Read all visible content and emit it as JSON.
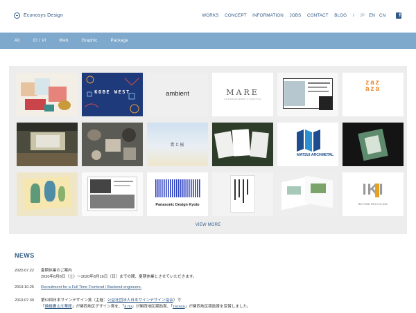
{
  "header": {
    "logo_text": "Econosys Design",
    "nav": [
      "WORKS",
      "CONCEPT",
      "INFORMATION",
      "JOBS",
      "CONTACT",
      "BLOG"
    ],
    "separator": "/",
    "languages": [
      "JP",
      "EN",
      "CN"
    ],
    "active_language": "EN",
    "facebook_icon": "facebook-icon"
  },
  "filters": [
    "All",
    "CI / VI",
    "Web",
    "Graphic",
    "Package"
  ],
  "gallery": {
    "tiles": [
      {
        "name": "tile-gift-boxes"
      },
      {
        "name": "tile-kobe-west",
        "text": "KOBE WEST"
      },
      {
        "name": "tile-ambient",
        "text": "ambient"
      },
      {
        "name": "tile-mare",
        "text": "MARE",
        "subtext": "HAIR ENHANCEMENT & HAIRSTYLE"
      },
      {
        "name": "tile-website-map"
      },
      {
        "name": "tile-zazaza",
        "text": "zazaza"
      },
      {
        "name": "tile-interior-room"
      },
      {
        "name": "tile-ceramics"
      },
      {
        "name": "tile-sky-gradient",
        "text": "青と桜"
      },
      {
        "name": "tile-brochures"
      },
      {
        "name": "tile-matsui-archmetal",
        "text": "MATSUI ARCHMETAL"
      },
      {
        "name": "tile-dark-card"
      },
      {
        "name": "tile-botanical-poster"
      },
      {
        "name": "tile-web-photo"
      },
      {
        "name": "tile-panasonic",
        "text": "Panasonic Design Kyoto"
      },
      {
        "name": "tile-book-cover"
      },
      {
        "name": "tile-folded-leaflets"
      },
      {
        "name": "tile-iki",
        "text": "IKI",
        "subtext": "BEYOND RECYCLING"
      }
    ],
    "view_more": "VIEW MORE"
  },
  "news": {
    "title": "NEWS",
    "items": [
      {
        "date": "2020.07.22",
        "text": "夏期休業のご案内",
        "sub": "2020年8月8日（土）〜2020年8月16日（日）までの間、夏期休業とさせていただきます。"
      },
      {
        "date": "2019.10.25",
        "link": "Recruitment for a Full Time Frontend / Backend engineers."
      },
      {
        "date": "2019.07.30",
        "text_a": "第53回日本サインデザイン賞（主催：",
        "link_a": "公益社団法人日本サインデザイン協会",
        "text_b": "）で",
        "sub_a": "「",
        "sub_link_a": "橋楼鷹山文華館",
        "sub_b": "」が関西地区デザイン賞を、「",
        "sub_link_b": "ā nu",
        "sub_c": "」が関西地区奨励賞、「",
        "sub_link_c": "zazaza",
        "sub_d": "」が関西地区奨励賞を受賞しました。"
      }
    ]
  },
  "colors": {
    "brand": "#2f5a86",
    "filter_bar": "#7fa9cc",
    "gallery_bg": "#ededed"
  }
}
